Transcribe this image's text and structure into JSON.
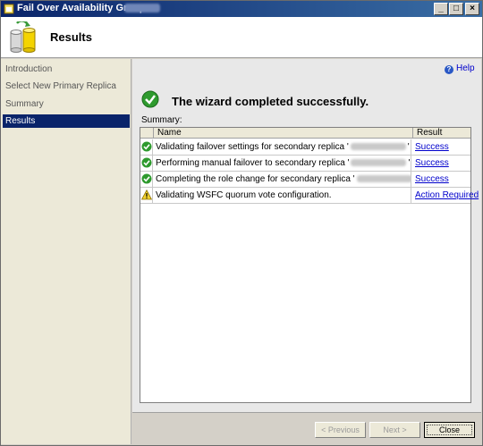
{
  "window": {
    "title": "Fail Over Availability Group:",
    "controls": {
      "minimize": "_",
      "maximize": "□",
      "close": "×"
    }
  },
  "header": {
    "title": "Results",
    "icon": "database-cylinders-icon"
  },
  "sidebar": {
    "items": [
      {
        "label": "Introduction",
        "active": false
      },
      {
        "label": "Select New Primary Replica",
        "active": false
      },
      {
        "label": "Summary",
        "active": false
      },
      {
        "label": "Results",
        "active": true
      }
    ]
  },
  "content": {
    "help_label": "Help",
    "status_message": "The wizard completed successfully.",
    "summary_label": "Summary:",
    "columns": {
      "name": "Name",
      "result": "Result"
    },
    "rows": [
      {
        "status": "success",
        "name_prefix": "Validating failover settings for secondary replica '",
        "name_suffix": "'",
        "result": "Success"
      },
      {
        "status": "success",
        "name_prefix": "Performing manual failover to secondary replica '",
        "name_suffix": "'",
        "result": "Success"
      },
      {
        "status": "success",
        "name_prefix": "Completing the role change for secondary replica '",
        "name_suffix": "'",
        "result": "Success"
      },
      {
        "status": "warning",
        "name_prefix": "Validating WSFC quorum vote configuration.",
        "name_suffix": "",
        "result": "Action Required"
      }
    ]
  },
  "footer": {
    "previous_label": "< Previous",
    "next_label": "Next >",
    "close_label": "Close"
  },
  "colors": {
    "title_gradient_start": "#0a246a",
    "success_green": "#2e9a2e",
    "warning_yellow": "#f2d22e",
    "link_blue": "#0000cc"
  }
}
